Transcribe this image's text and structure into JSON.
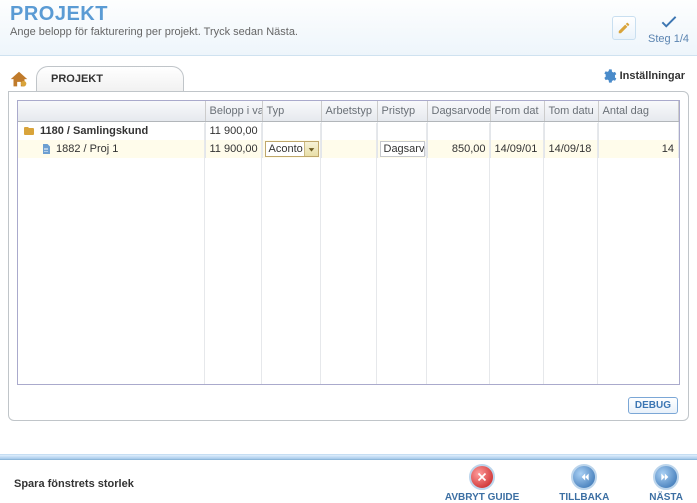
{
  "header": {
    "title": "PROJEKT",
    "subtitle": "Ange belopp för fakturering per projekt. Tryck sedan Nästa.",
    "step": "Steg 1/4"
  },
  "tab": {
    "label": "PROJEKT"
  },
  "settings": {
    "label": "Inställningar"
  },
  "columns": [
    "",
    "Belopp i val",
    "Typ",
    "Arbetstyp",
    "Pristyp",
    "Dagsarvode",
    "From dat",
    "Tom datu",
    "Antal dag"
  ],
  "rows": {
    "parent": {
      "label": "1180 / Samlingskund",
      "belopp": "11 900,00"
    },
    "child": {
      "label": "1882 / Proj 1",
      "belopp": "11 900,00",
      "typ": "Aconto",
      "arbetstyp": "",
      "pristyp": "Dagsarv",
      "dagsarvode": "850,00",
      "from": "14/09/01",
      "tom": "14/09/18",
      "antal": "14"
    }
  },
  "debug": "DEBUG",
  "footer": {
    "left": "Spara fönstrets storlek",
    "cancel": "AVBRYT GUIDE",
    "back": "TILLBAKA",
    "next": "NÄSTA"
  }
}
